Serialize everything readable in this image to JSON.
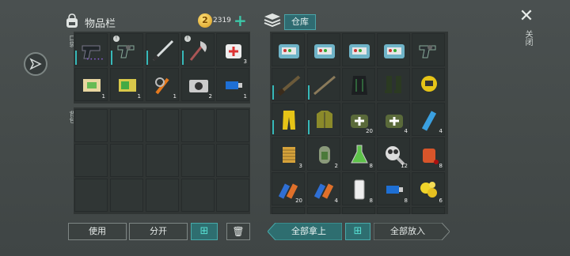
{
  "header": {
    "title": "物品栏",
    "coins": "2319",
    "plus": "+",
    "warehouse_tab": "仓库",
    "close_label": "关闭"
  },
  "sections": {
    "quick": "口袋",
    "backpack": "背包"
  },
  "equip_row1": [
    {
      "name": "pistol-icon",
      "count": "",
      "locked": false,
      "dots": "•••••"
    },
    {
      "name": "revolver-icon",
      "count": "",
      "locked": true,
      "dots": ""
    },
    {
      "name": "katana-icon",
      "count": "",
      "locked": false,
      "dots": ""
    },
    {
      "name": "axe-icon",
      "count": "",
      "locked": true,
      "dots": ""
    },
    {
      "name": "medkit-icon",
      "count": "3",
      "locked": false,
      "dots": ""
    }
  ],
  "equip_row2": [
    {
      "name": "bandage-icon",
      "count": "1"
    },
    {
      "name": "battery-icon",
      "count": "1"
    },
    {
      "name": "pliers-icon",
      "count": "1"
    },
    {
      "name": "camera-icon",
      "count": "2"
    },
    {
      "name": "usb-drive-icon",
      "count": "1"
    }
  ],
  "storage_rows": [
    [
      {
        "name": "toolbox-icon",
        "count": ""
      },
      {
        "name": "toolbox-icon",
        "count": ""
      },
      {
        "name": "toolbox-icon",
        "count": ""
      },
      {
        "name": "toolbox-icon",
        "count": ""
      },
      {
        "name": "revolver-icon",
        "count": ""
      }
    ],
    [
      {
        "name": "rifle-icon",
        "count": ""
      },
      {
        "name": "shotgun-icon",
        "count": ""
      },
      {
        "name": "armor-black-icon",
        "count": ""
      },
      {
        "name": "boots-icon",
        "count": ""
      },
      {
        "name": "hazmat-helmet-icon",
        "count": ""
      }
    ],
    [
      {
        "name": "hazmat-pants-icon",
        "count": ""
      },
      {
        "name": "hazmat-jacket-icon",
        "count": ""
      },
      {
        "name": "medkit-bag-icon",
        "count": "20"
      },
      {
        "name": "medkit-bag-icon",
        "count": "4"
      },
      {
        "name": "water-bottle-icon",
        "count": "4"
      }
    ],
    [
      {
        "name": "filter-icon",
        "count": "3"
      },
      {
        "name": "canteen-icon",
        "count": "2"
      },
      {
        "name": "flask-icon",
        "count": "8"
      },
      {
        "name": "gasmask-icon",
        "count": "12"
      },
      {
        "name": "jar-berries-icon",
        "count": "8"
      }
    ],
    [
      {
        "name": "battery-cell-icon",
        "count": "20"
      },
      {
        "name": "battery-cell-icon",
        "count": "4"
      },
      {
        "name": "phone-icon",
        "count": "8"
      },
      {
        "name": "usb-drive-icon",
        "count": "8"
      },
      {
        "name": "gold-nuggets-icon",
        "count": "6"
      }
    ]
  ],
  "buttons": {
    "use": "使用",
    "split": "分开",
    "take_all": "全部拿上",
    "put_all": "全部放入",
    "sort": "⊞",
    "trash": "🗑"
  }
}
